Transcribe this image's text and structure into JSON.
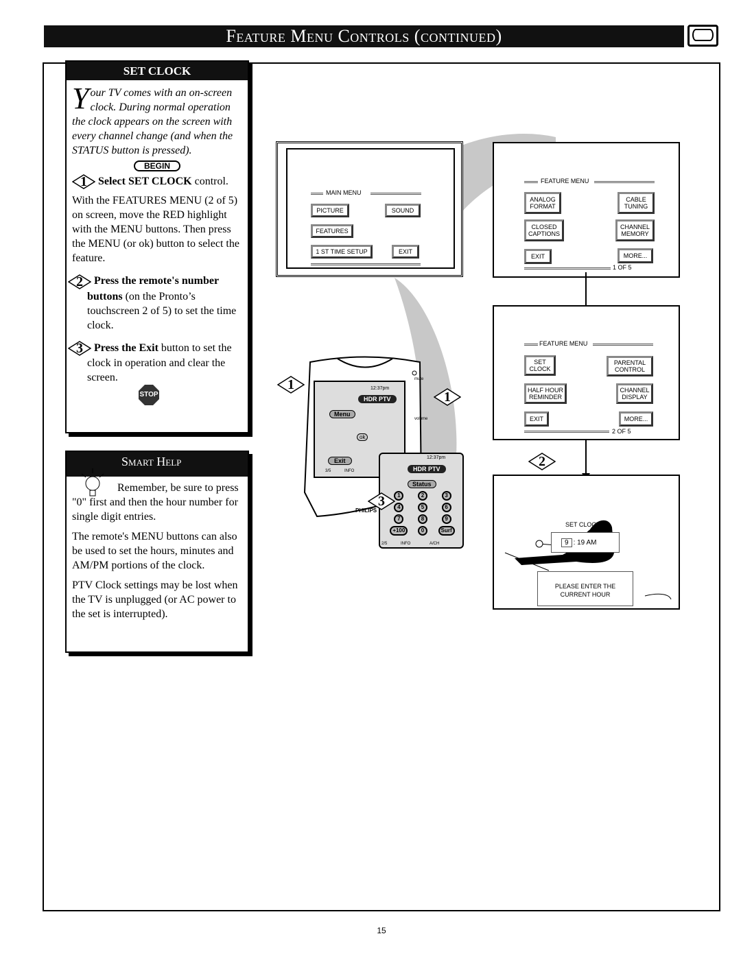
{
  "header": {
    "title": "Feature Menu Controls (continued)"
  },
  "set_clock": {
    "title": "SET CLOCK",
    "intro_initial": "Y",
    "intro": "our TV comes with an on-screen clock. During normal operation the clock appears on the screen with every channel change (and when the STATUS button is pressed).",
    "begin": "BEGIN",
    "steps": [
      {
        "num": "1",
        "bold": "Select SET CLOCK",
        "rest": " control.",
        "detail": "With the FEATURES MENU (2 of 5) on screen, move the RED highlight with the MENU buttons. Then press the MENU (or ok) button to select the feature."
      },
      {
        "num": "2",
        "bold": "Press the remote's number buttons",
        "rest": " (on the Pronto’s touchscreen 2 of 5) to set the time clock."
      },
      {
        "num": "3",
        "bold": "Press the Exit",
        "rest": " button to set the clock in operation and clear the screen."
      }
    ],
    "stop": "STOP"
  },
  "smart_help": {
    "title": "Smart Help",
    "paragraphs": [
      "Remember, be sure to press \"0\" first and then the hour number for single digit entries.",
      "The remote's MENU buttons can also be used to set the hours, minutes and AM/PM portions of the clock.",
      "PTV Clock settings may be lost when the TV is unplugged (or AC power to the set is interrupted)."
    ]
  },
  "main_menu": {
    "title": "MAIN MENU",
    "items": [
      "PICTURE",
      "SOUND",
      "FEATURES",
      "1 ST TIME SETUP",
      "EXIT"
    ],
    "highlighted": "FEATURES"
  },
  "feature_menu_1": {
    "title": "FEATURE MENU",
    "items": [
      "ANALOG FORMAT",
      "CABLE TUNING",
      "CLOSED CAPTIONS",
      "CHANNEL MEMORY",
      "EXIT",
      "MORE..."
    ],
    "page": "1  OF 5",
    "highlighted": "MORE..."
  },
  "feature_menu_2": {
    "title": "FEATURE MENU",
    "items": [
      "SET CLOCK",
      "PARENTAL CONTROL",
      "HALF HOUR REMINDER",
      "CHANNEL DISPLAY",
      "EXIT",
      "MORE..."
    ],
    "page": "2  OF 5",
    "highlighted": "SET CLOCK"
  },
  "set_clock_screen": {
    "title": "SET CLOCK",
    "hour": "9",
    "rest": ": 19  AM",
    "prompt": "PLEASE ENTER THE CURRENT HOUR"
  },
  "remote": {
    "time": "12:37pm",
    "device": "HDR PTV",
    "menu": "Menu",
    "ok": "ok",
    "exit": "Exit",
    "page_a": "3/5",
    "info": "INFO",
    "ach": "A/CH",
    "mute": "mute",
    "volume": "volume",
    "brand": "PHILIPS",
    "status": "Status",
    "keys": [
      "1",
      "2",
      "3",
      "4",
      "5",
      "6",
      "7",
      "8",
      "9",
      "+100",
      "0",
      "Surf"
    ],
    "page_b": "2/5",
    "callouts": [
      "1",
      "1",
      "2",
      "3"
    ]
  },
  "page_number": "15"
}
